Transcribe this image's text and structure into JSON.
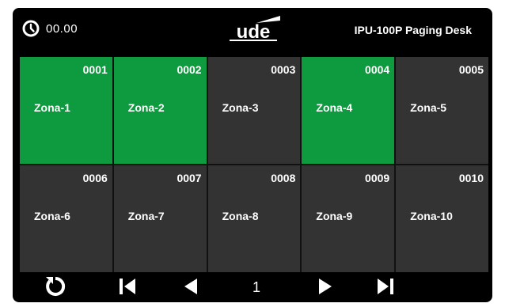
{
  "header": {
    "clock": "00.00",
    "logo_text": "ude",
    "title": "IPU-100P  Paging Desk"
  },
  "zones": [
    {
      "code": "0001",
      "name": "Zona-1",
      "active": true
    },
    {
      "code": "0002",
      "name": "Zona-2",
      "active": true
    },
    {
      "code": "0003",
      "name": "Zona-3",
      "active": false
    },
    {
      "code": "0004",
      "name": "Zona-4",
      "active": true
    },
    {
      "code": "0005",
      "name": "Zona-5",
      "active": false
    },
    {
      "code": "0006",
      "name": "Zona-6",
      "active": false
    },
    {
      "code": "0007",
      "name": "Zona-7",
      "active": false
    },
    {
      "code": "0008",
      "name": "Zona-8",
      "active": false
    },
    {
      "code": "0009",
      "name": "Zona-9",
      "active": false
    },
    {
      "code": "0010",
      "name": "Zona-10",
      "active": false
    }
  ],
  "footer": {
    "page": "1",
    "controls": [
      "refresh-icon",
      "first-page-icon",
      "prev-page-icon",
      "next-page-icon",
      "last-page-icon"
    ]
  },
  "colors": {
    "background": "#000000",
    "zone_active": "#0e9a3e",
    "zone_inactive": "#333333",
    "text": "#ffffff"
  }
}
